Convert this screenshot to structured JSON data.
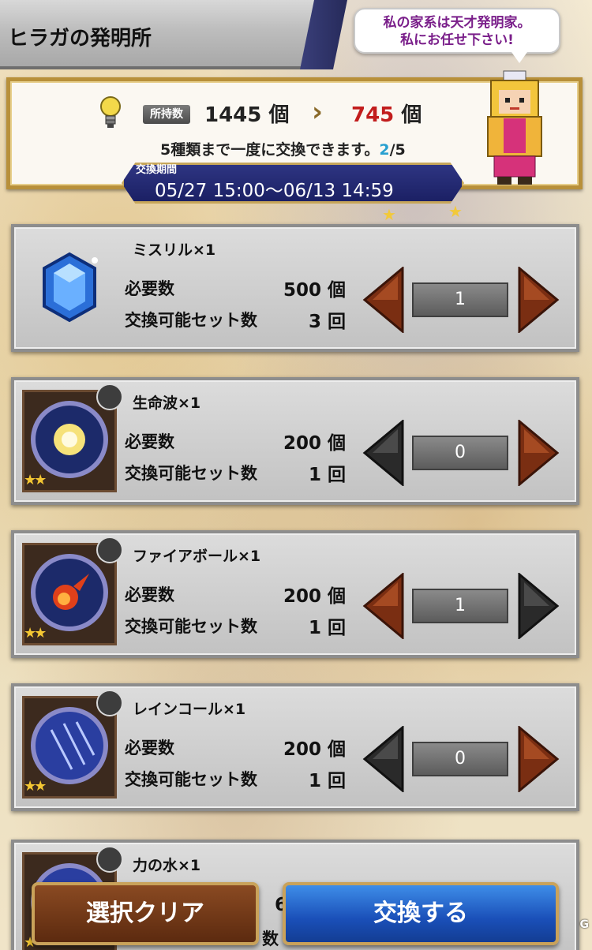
{
  "header": {
    "title": "ヒラガの発明所",
    "speech_line1": "私の家系は天才発明家。",
    "speech_line2": "私にお任せ下さい!"
  },
  "info": {
    "owned_label": "所持数",
    "owned_current": "1445",
    "owned_after": "745",
    "unit": "個",
    "exchange_note_prefix": "5種類まで一度に交換できます。",
    "exchange_count": "2",
    "exchange_limit": "/5",
    "period_label": "交換期間",
    "period_value": "05/27 15:00～06/13 14:59"
  },
  "items": [
    {
      "name": "ミスリル×1",
      "req_label": "必要数",
      "req_value": "500 個",
      "sets_label": "交換可能セット数",
      "sets_value": "3 回",
      "quantity": "1",
      "icon": "mythril-crystal-icon",
      "rarity": ""
    },
    {
      "name": "生命波×1",
      "req_label": "必要数",
      "req_value": "200 個",
      "sets_label": "交換可能セット数",
      "sets_value": "1 回",
      "quantity": "0",
      "icon": "life-wave-orb-icon",
      "rarity": "★★"
    },
    {
      "name": "ファイアボール×1",
      "req_label": "必要数",
      "req_value": "200 個",
      "sets_label": "交換可能セット数",
      "sets_value": "1 回",
      "quantity": "1",
      "icon": "fireball-orb-icon",
      "rarity": "★★"
    },
    {
      "name": "レインコール×1",
      "req_label": "必要数",
      "req_value": "200 個",
      "sets_label": "交換可能セット数",
      "sets_value": "1 回",
      "quantity": "0",
      "icon": "rain-call-orb-icon",
      "rarity": "★★"
    },
    {
      "name": "力の水×1",
      "req_partial": "6",
      "sets_partial": "数",
      "icon": "power-water-orb-icon",
      "rarity": "★"
    }
  ],
  "buttons": {
    "clear": "選択クリア",
    "exchange": "交換する"
  },
  "watermark": "G",
  "colors": {
    "accent_gold": "#b8903a",
    "period_blue": "#1b2064",
    "after_red": "#c21d1d",
    "count_cyan": "#28a0d0",
    "arrow_active": "#7a2e12",
    "arrow_inactive": "#2a2a2a"
  }
}
